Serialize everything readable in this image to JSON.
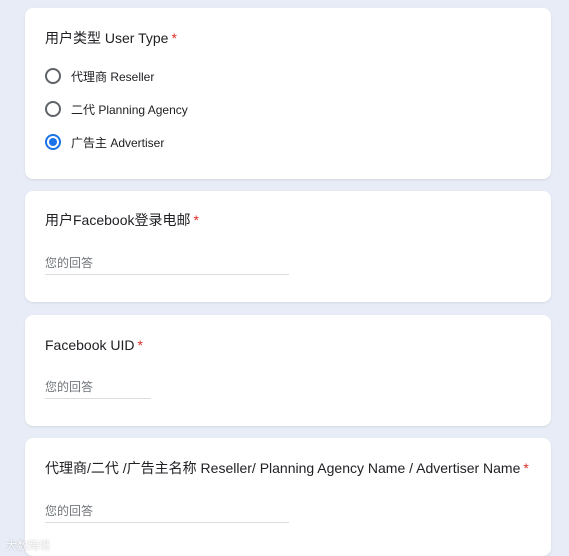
{
  "q1": {
    "title": "用户类型 User Type",
    "required_mark": "*",
    "options": [
      {
        "label": "代理商 Reseller",
        "selected": false
      },
      {
        "label": "二代 Planning Agency",
        "selected": false
      },
      {
        "label": "广告主 Advertiser",
        "selected": true
      }
    ]
  },
  "q2": {
    "title": "用户Facebook登录电邮",
    "required_mark": "*",
    "placeholder": "您的回答"
  },
  "q3": {
    "title": "Facebook UID",
    "required_mark": "*",
    "placeholder": "您的回答"
  },
  "q4": {
    "title": "代理商/二代 /广告主名称 Reseller/ Planning Agency Name / Advertiser Name",
    "required_mark": "*",
    "placeholder": "您的回答"
  },
  "watermark": "大数跨境",
  "colors": {
    "accent": "#1a73e8",
    "required": "#d93025",
    "background": "#e8ecf6"
  }
}
